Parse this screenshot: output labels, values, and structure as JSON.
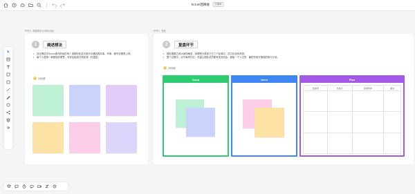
{
  "doc": {
    "title": "Scrum回顾会",
    "badge": "已保存"
  },
  "colors": {
    "good": "#2ecc71",
    "need": "#3f86f5",
    "plan": "#a259e6",
    "sticky_green": "#bdf0d4",
    "sticky_blue": "#c9d3fb",
    "sticky_purple": "#e3ccf8",
    "sticky_yellow": "#fde2a6",
    "sticky_pink": "#fbcde6",
    "sticky_lavender": "#dcd6fb"
  },
  "topbar_icons": [
    "home-icon",
    "history-icon",
    "cloud-icon",
    "folder-icon",
    "search-icon",
    "undo-icon",
    "redo-icon"
  ],
  "left_tools": [
    "select-icon",
    "frame-icon",
    "text-icon",
    "sticky-note-icon",
    "shape-icon",
    "line-icon",
    "pen-icon",
    "circle-icon",
    "connector-icon",
    "template-icon",
    "more-icon"
  ],
  "bottom_tools": [
    "layers-icon",
    "comment-icon",
    "timer-icon",
    "chat-icon",
    "video-icon",
    "zoom-icon",
    "share-icon"
  ],
  "frame1": {
    "caption": "环节1：阐述想法 (计时8分钟)",
    "step": "1",
    "title": "阐述想法",
    "bullets": [
      "还记得这次Scrum迭代的经历吗？请把你在这次迭代中遇到的好事、坏事，都写在便签上吧。",
      "每个人选择一种颜色的便签，写好后贴到左侧区域（可重复）"
    ],
    "timer": "10分钟"
  },
  "frame2": {
    "caption": "环节2：复盘",
    "step": "2",
    "title": "复盘环节",
    "bullets": [
      "团队根据之前大家的阐述，将便签分类到下方三个区域中，并讨论如何改进。",
      "整个过程中，对于每项讨论，尽量让团队成员都有发言机会，避免一个人主导，最终形成可落地的执行计划。"
    ],
    "timer": "20分钟",
    "columns": {
      "good": "Good",
      "need": "Need",
      "plan": "Plan"
    },
    "plan_headers": [
      "改进项",
      "负责人",
      "完成时间",
      "备注"
    ]
  }
}
